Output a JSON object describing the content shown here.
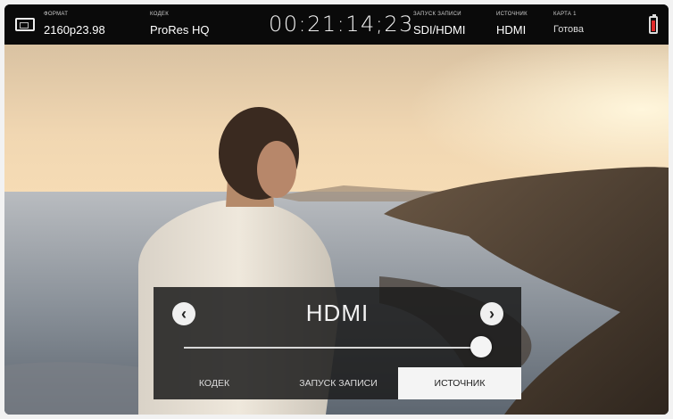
{
  "status_bar": {
    "format": {
      "label": "ФОРМАТ",
      "value": "2160p23.98"
    },
    "codec": {
      "label": "КОДЕК",
      "value": "ProRes HQ"
    },
    "timecode": "00:21:14;23",
    "record_trigger": {
      "label": "ЗАПУСК ЗАПИСИ",
      "value": "SDI/HDMI"
    },
    "source": {
      "label": "ИСТОЧНИК",
      "value": "HDMI"
    },
    "card": {
      "label": "КАРТА 1",
      "value": "Готова"
    }
  },
  "panel": {
    "value": "HDMI",
    "prev_symbol": "‹",
    "next_symbol": "›",
    "slider_position": 1.0,
    "tabs": [
      {
        "label": "КОДЕК",
        "active": false
      },
      {
        "label": "ЗАПУСК ЗАПИСИ",
        "active": false
      },
      {
        "label": "ИСТОЧНИК",
        "active": true
      }
    ]
  },
  "colors": {
    "active_tab_bg": "#f4f4f4",
    "battery_low": "#e02a2a"
  }
}
